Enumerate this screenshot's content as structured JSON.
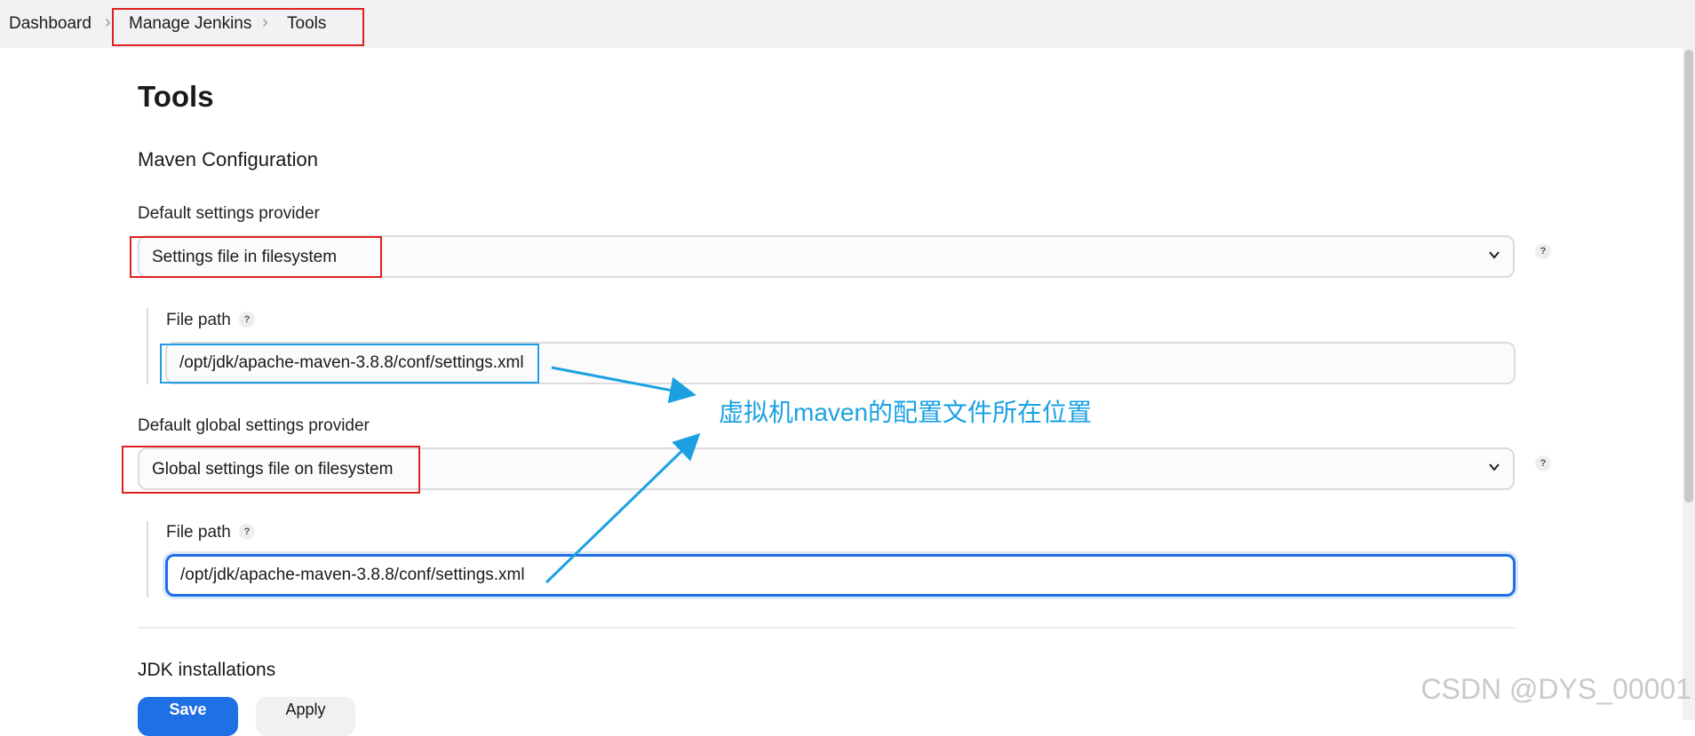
{
  "breadcrumb": {
    "items": [
      "Dashboard",
      "Manage Jenkins",
      "Tools"
    ]
  },
  "page": {
    "title": "Tools",
    "section_title": "Maven Configuration"
  },
  "maven": {
    "default_settings_label": "Default settings provider",
    "default_settings_value": "Settings file in filesystem",
    "file_path_label": "File path",
    "file_path_value": "/opt/jdk/apache-maven-3.8.8/conf/settings.xml",
    "default_global_label": "Default global settings provider",
    "default_global_value": "Global settings file on filesystem",
    "global_file_path_label": "File path",
    "global_file_path_value": "/opt/jdk/apache-maven-3.8.8/conf/settings.xml"
  },
  "jdk": {
    "heading": "JDK installations"
  },
  "buttons": {
    "save": "Save",
    "apply": "Apply"
  },
  "help": "?",
  "annotation": {
    "text": "虚拟机maven的配置文件所在位置"
  },
  "watermark": "CSDN @DYS_00001",
  "icons": {
    "chevron": "chevron-down-icon",
    "help": "help-icon",
    "separator": "chevron-right-icon"
  },
  "colors": {
    "primary": "#1f6fe5",
    "annotation": "#1ba1e2",
    "highlight_red": "#e02020",
    "highlight_blue": "#1f9ee8"
  }
}
